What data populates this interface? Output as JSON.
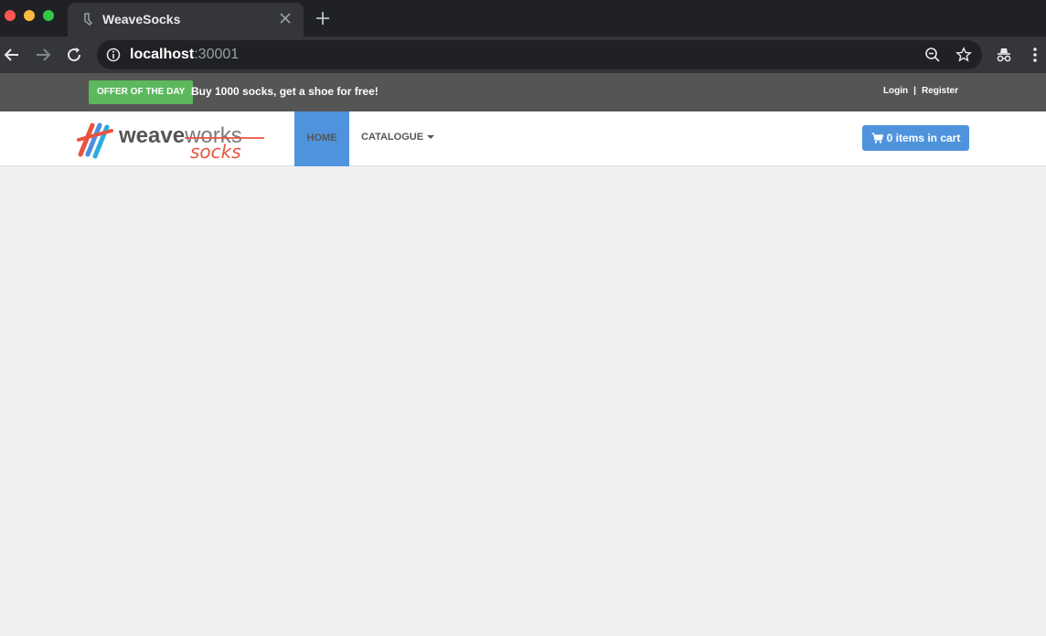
{
  "browser": {
    "tab_title": "WeaveSocks",
    "url_host": "localhost",
    "url_port": ":30001"
  },
  "topbar": {
    "offer_badge": "OFFER OF THE DAY",
    "offer_text": "Buy 1000 socks, get a shoe for free!",
    "login": "Login",
    "separator": "|",
    "register": "Register"
  },
  "navbar": {
    "logo_primary": "weave",
    "logo_secondary": "works",
    "logo_sub": "socks",
    "home": "HOME",
    "catalogue": "CATALOGUE",
    "cart": "0 items in cart"
  },
  "colors": {
    "accent_blue": "#4f93dc",
    "offer_green": "#5cb85c",
    "logo_orange": "#e8543f",
    "logo_gray": "#555555"
  }
}
